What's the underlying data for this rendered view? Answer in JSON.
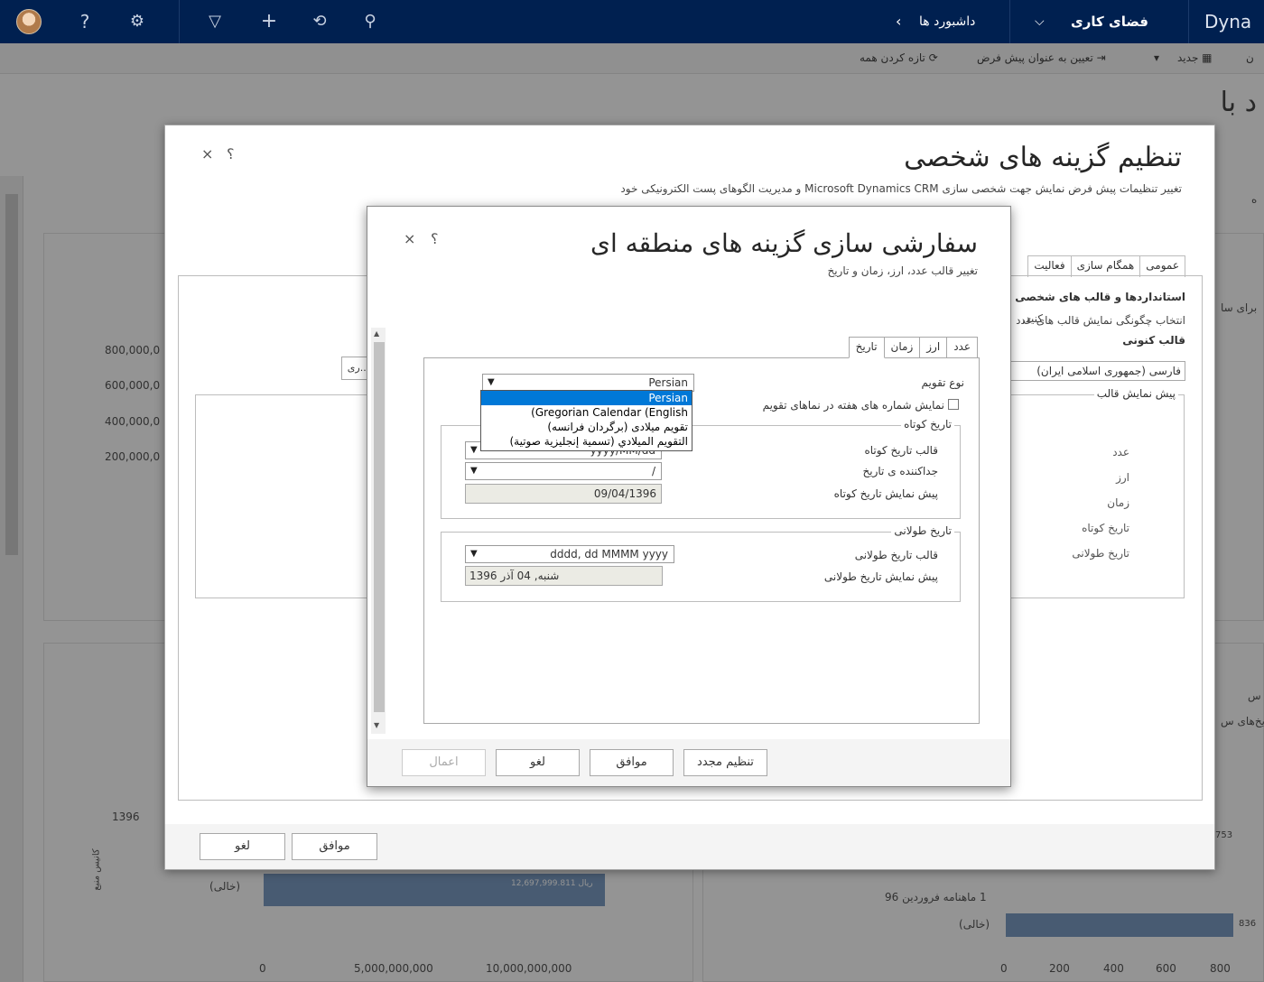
{
  "topbar": {
    "brand": "Dyna",
    "workspace": "فضای کاری",
    "workspace_chevron": "⌵",
    "breadcrumb": "داشبورد ها",
    "breadcrumb_chevron": "‹",
    "icons": [
      "search-icon",
      "history-icon",
      "add-icon",
      "filter-icon",
      "settings-icon",
      "help-icon",
      "avatar"
    ]
  },
  "commandbar": {
    "new_label": "جدید",
    "set_default_label": "تعیین به عنوان پیش فرض",
    "refresh_all_label": "تازه کردن همه",
    "prefix": "ن"
  },
  "background": {
    "page_title": "د با",
    "y_ticks": [
      "800,000,0",
      "600,000,0",
      "400,000,0",
      "200,000,0"
    ],
    "year_label": "1396",
    "vert_label": "کانیس منبع",
    "empty_label": "(خالی)",
    "bar_value": "12,697,999.811 ریال",
    "x_ticks": [
      "0",
      "5,000,000,000",
      "10,000,000,000"
    ],
    "right_label_1": "1 ماهنامه فروردین 96",
    "right_empty": "(خالی)",
    "right_value": "836",
    "right_value_2": "753",
    "right_x_ticks": [
      "0",
      "200",
      "400",
      "600",
      "800"
    ],
    "side_text_1": "برای سا",
    "side_text_2": "س",
    "side_text_3": "یخ‌های س",
    "side_text_4": "ه",
    "mid_text": "کنید,",
    "mid_button": "ری..."
  },
  "outer_dialog": {
    "title": "تنظیم گزینه های شخصی",
    "subtitle": "تغییر تنظیمات پیش فرض نمایش جهت شخصی سازی Microsoft Dynamics CRM و مدیریت الگوهای پست الکترونیکی خود",
    "help": "؟",
    "close": "×",
    "tabs": [
      "عمومی",
      "همگام سازی",
      "فعالیت"
    ],
    "section_heading": "استانداردها و قالب های شخصی",
    "section_desc": "انتخاب چگونگی نمایش قالب های عدد",
    "current_format_label": "قالب کنونی",
    "current_format_value": "فارسی (جمهوری اسلامی ایران)",
    "preview_legend": "پیش نمایش قالب",
    "preview_rows": [
      "عدد",
      "ارز",
      "زمان",
      "تاریخ کوتاه",
      "تاریخ طولانی"
    ],
    "ok": "موافق",
    "cancel": "لغو"
  },
  "inner_dialog": {
    "title": "سفارشی سازی گزینه های منطقه ای",
    "subtitle": "تغییر قالب عدد، ارز، زمان و تاریخ",
    "help": "؟",
    "close": "×",
    "tabs": [
      "عدد",
      "ارز",
      "زمان",
      "تاریخ"
    ],
    "active_tab": "تاریخ",
    "calendar_type_label": "نوع تقویم",
    "calendar_type_value": "Persian",
    "calendar_options": [
      "Persian",
      "(Gregorian Calendar (English",
      "تقویم میلادی (برگردان فرانسه)",
      "التقويم الميلادي (تسمية إنجليزية صوتية)"
    ],
    "week_numbers_label": "نمایش شماره های هفته در نماهای تقویم",
    "short_date_legend": "تاریخ کوتاه",
    "short_date_format_label": "قالب تاریخ کوتاه",
    "short_date_format_value": "yyyy/MM/dd",
    "date_separator_label": "جداکننده ی تاریخ",
    "date_separator_value": "/",
    "short_preview_label": "پیش نمایش تاریخ کوتاه",
    "short_preview_value": "09/04/1396",
    "long_date_legend": "تاریخ طولانی",
    "long_date_format_label": "قالب تاریخ طولانی",
    "long_date_format_value": "dddd, dd MMMM yyyy",
    "long_preview_label": "پیش نمایش تاریخ طولانی",
    "long_preview_value": "شنبه, 04 آذر 1396",
    "btn_reset": "تنظیم مجدد",
    "btn_ok": "موافق",
    "btn_cancel": "لغو",
    "btn_apply": "اعمال"
  }
}
